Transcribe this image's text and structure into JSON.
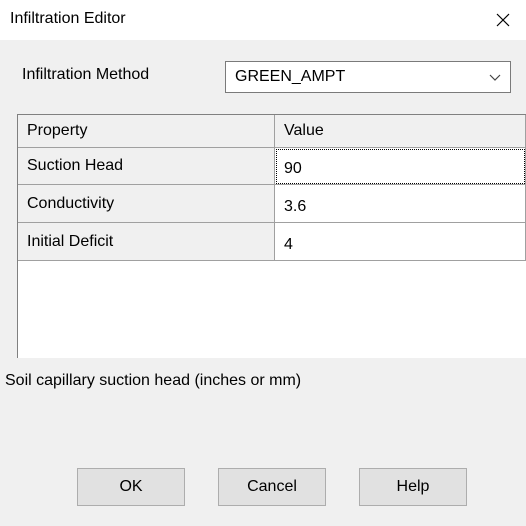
{
  "window": {
    "title": "Infiltration Editor",
    "close_icon": "close-icon"
  },
  "method": {
    "label": "Infiltration Method",
    "value": "GREEN_AMPT",
    "dropdown_icon": "chevron-down-icon"
  },
  "grid": {
    "headers": [
      "Property",
      "Value"
    ],
    "rows": [
      {
        "property": "Suction Head",
        "value": "90"
      },
      {
        "property": "Conductivity",
        "value": "3.6"
      },
      {
        "property": "Initial Deficit",
        "value": "4"
      }
    ]
  },
  "hint": "Soil capillary suction head (inches or mm)",
  "buttons": {
    "ok": "OK",
    "cancel": "Cancel",
    "help": "Help"
  },
  "colors": {
    "dialog_background": "#f0f0f0",
    "titlebar_background": "#ffffff",
    "grid_line": "#a0a0a0",
    "button_face": "#e1e1e1"
  }
}
